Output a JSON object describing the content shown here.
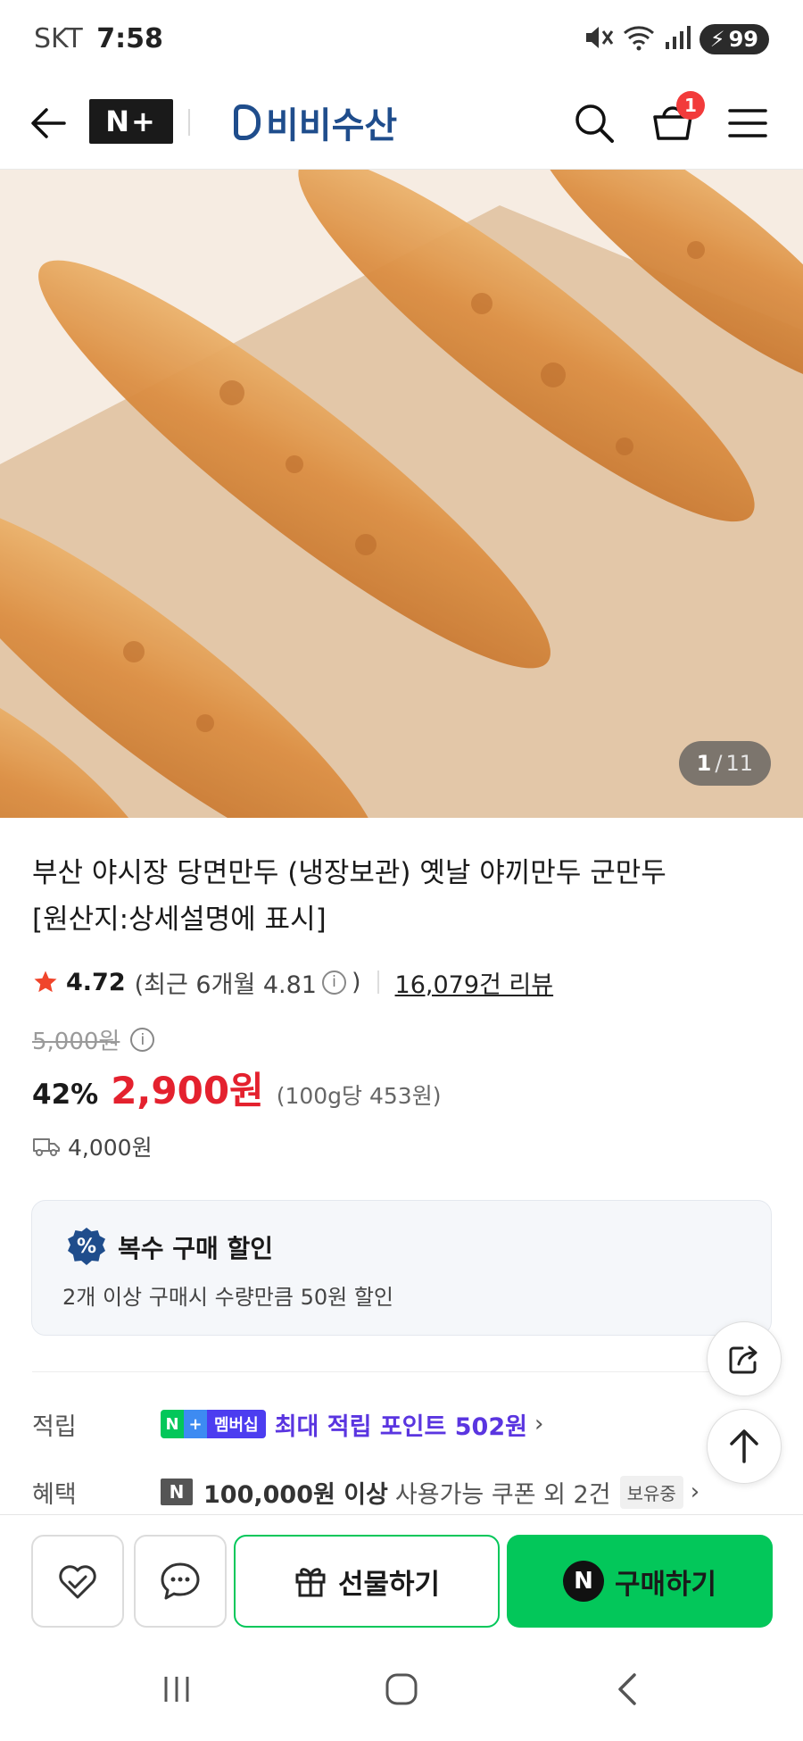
{
  "status_bar": {
    "carrier": "SKT",
    "time": "7:58",
    "battery": "99"
  },
  "header": {
    "nplus_logo": "N+",
    "brand_name": "비비수산",
    "cart_count": "1"
  },
  "gallery": {
    "current": "1",
    "separator": "/",
    "total": "11"
  },
  "product": {
    "title_line1": "부산 야시장 당면만두 (냉장보관) 옛날 야끼만두 군만두",
    "title_line2": "[원산지:상세설명에 표시]",
    "rating": "4.72",
    "recent_rating_prefix": "(최근 6개월 4.81",
    "recent_rating_suffix": ")",
    "review_count": "16,079건 리뷰",
    "original_price": "5,000원",
    "discount_rate": "42%",
    "sale_price": "2,900원",
    "unit_price": "(100g당 453원)",
    "shipping_fee": "4,000원"
  },
  "bulk_discount": {
    "badge": "%",
    "title": "복수 구매 할인",
    "description": "2개 이상 구매시 수량만큼 50원 할인"
  },
  "benefits": {
    "points_label": "적립",
    "membership_n": "N",
    "membership_plus": "+",
    "membership_text": "멤버십",
    "points_text": "최대 적립 포인트 502원",
    "coupon_label": "혜택",
    "coupon_icon": "N",
    "coupon_amount": "100,000원 이상",
    "coupon_rest": "사용가능 쿠폰 외 2건",
    "coupon_owned": "보유중"
  },
  "bottom_bar": {
    "gift_label": "선물하기",
    "buy_n": "N",
    "buy_label": "구매하기"
  },
  "colors": {
    "brand_blue": "#1f4d8c",
    "sale_red": "#e4212e",
    "naver_green": "#03c75a",
    "points_purple": "#5a35e0",
    "rating_star": "#f0452b"
  }
}
